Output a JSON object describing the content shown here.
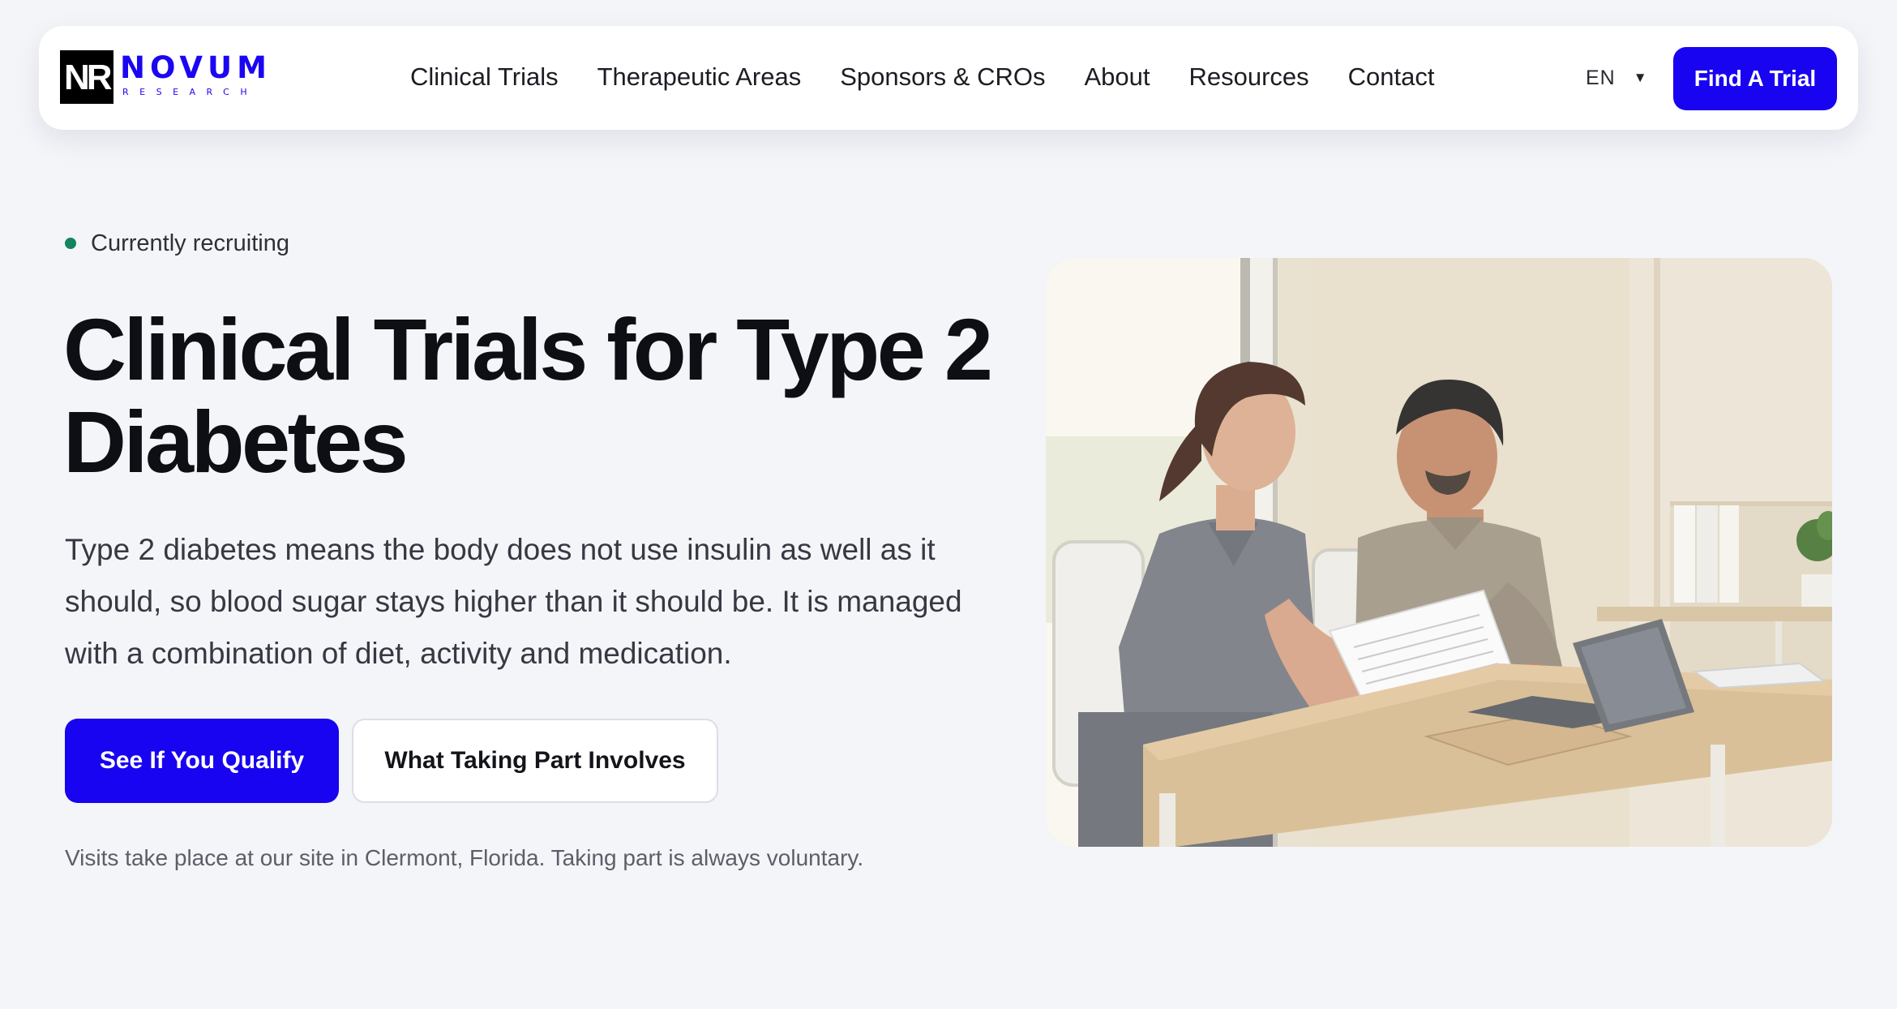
{
  "brand": {
    "logo_initials": "NR",
    "name": "NOVUM",
    "tagline": "RESEARCH",
    "color": "#1b06f2"
  },
  "nav": {
    "items": [
      {
        "label": "Clinical Trials"
      },
      {
        "label": "Therapeutic Areas"
      },
      {
        "label": "Sponsors & CROs"
      },
      {
        "label": "About"
      },
      {
        "label": "Resources"
      },
      {
        "label": "Contact"
      }
    ],
    "language": "EN",
    "language_icon": "chevron-down-icon",
    "cta_label": "Find A Trial"
  },
  "hero": {
    "status_text": "Currently recruiting",
    "status_color": "#12855f",
    "title": "Clinical Trials for Type 2 Diabetes",
    "description": "Type 2 diabetes means the body does not use insulin as well as it should, so blood sugar stays higher than it should be. It is managed with a combination of diet, activity and medication.",
    "primary_button": "See If You Qualify",
    "secondary_button": "What Taking Part Involves",
    "note": "Visits take place at our site in Clermont, Florida. Taking part is always voluntary."
  },
  "colors": {
    "accent": "#1804f0",
    "background": "#f4f5f9"
  }
}
